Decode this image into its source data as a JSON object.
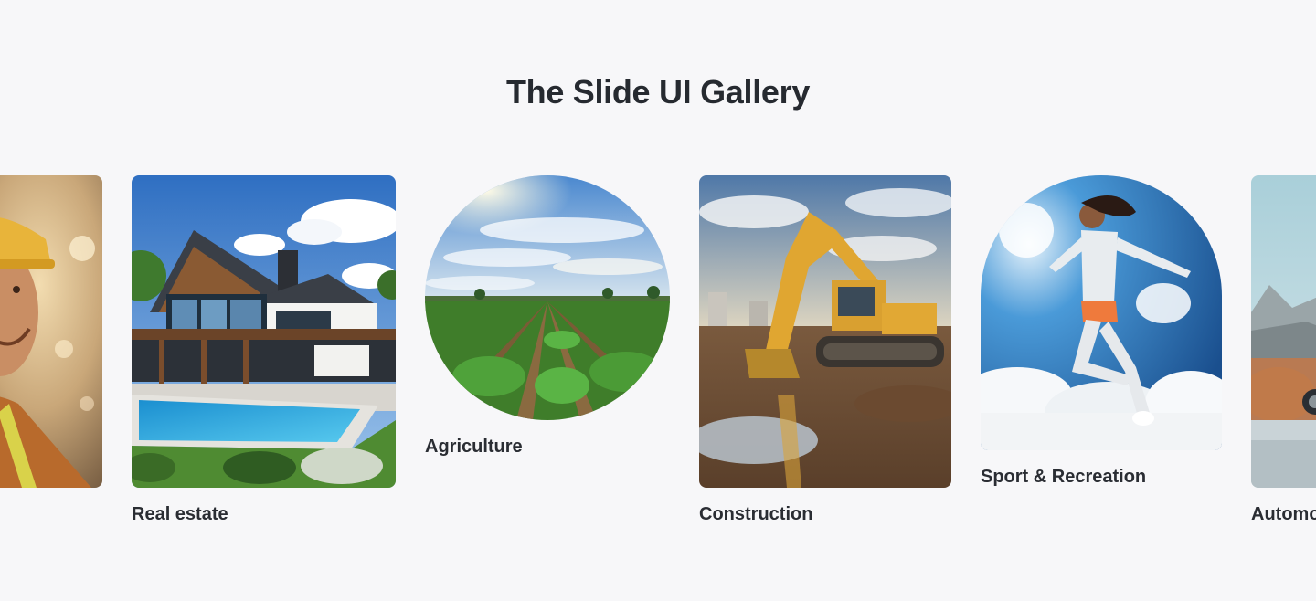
{
  "gallery": {
    "title": "The Slide UI Gallery",
    "slides": [
      {
        "label": "",
        "image": "construction-worker-photo"
      },
      {
        "label": "Real estate",
        "image": "modern-house-with-pool-photo"
      },
      {
        "label": "Agriculture",
        "image": "crop-field-photo"
      },
      {
        "label": "Construction",
        "image": "excavator-on-site-photo"
      },
      {
        "label": "Sport & Recreation",
        "image": "jumping-athlete-photo"
      },
      {
        "label": "Automo",
        "image": "car-on-coastal-road-photo"
      }
    ]
  },
  "colors": {
    "background": "#f7f7f9",
    "title_text": "#262a30",
    "label_text": "#2a2d33"
  }
}
